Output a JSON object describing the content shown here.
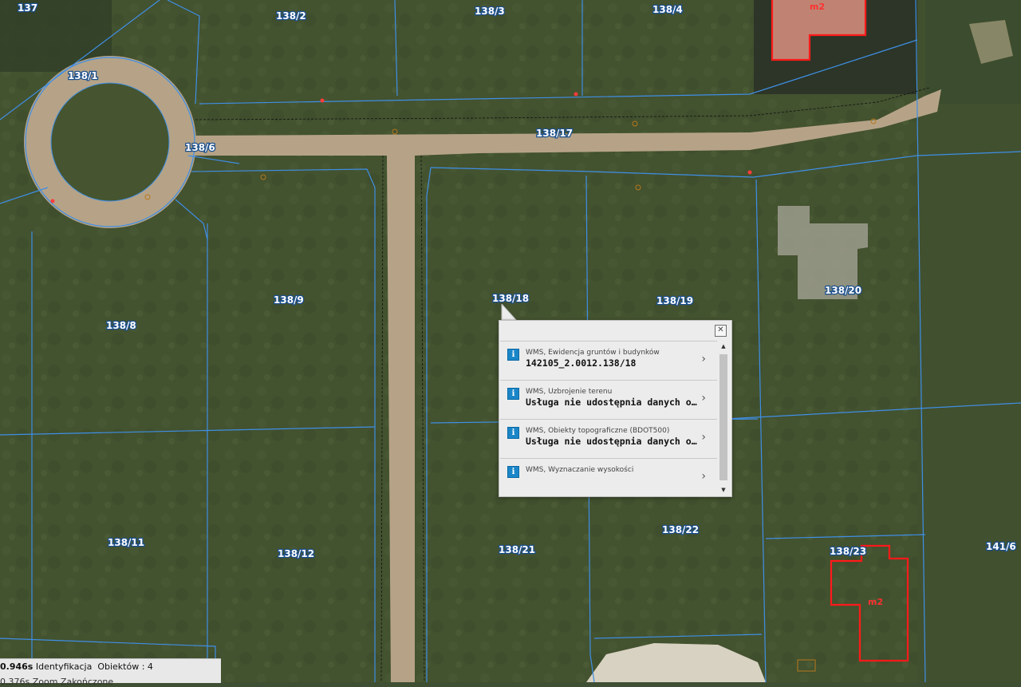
{
  "map": {
    "parcels": [
      {
        "id": "p137",
        "label": "137"
      },
      {
        "id": "p138_2",
        "label": "138/2"
      },
      {
        "id": "p138_3",
        "label": "138/3"
      },
      {
        "id": "p138_4",
        "label": "138/4"
      },
      {
        "id": "p138_1",
        "label": "138/1"
      },
      {
        "id": "p138_6",
        "label": "138/6"
      },
      {
        "id": "p138_17",
        "label": "138/17"
      },
      {
        "id": "p138_8",
        "label": "138/8"
      },
      {
        "id": "p138_9",
        "label": "138/9"
      },
      {
        "id": "p138_18",
        "label": "138/18"
      },
      {
        "id": "p138_19",
        "label": "138/19"
      },
      {
        "id": "p138_20",
        "label": "138/20"
      },
      {
        "id": "p138_11",
        "label": "138/11"
      },
      {
        "id": "p138_12",
        "label": "138/12"
      },
      {
        "id": "p138_21",
        "label": "138/21"
      },
      {
        "id": "p138_22",
        "label": "138/22"
      },
      {
        "id": "p138_23",
        "label": "138/23"
      },
      {
        "id": "p141_6",
        "label": "141/6"
      }
    ],
    "building_labels": [
      "m2",
      "m2"
    ],
    "colors": {
      "parcel_line": "#3f8fe6",
      "building": "#ff1a1a",
      "label_halo": "#1b4f8c",
      "road": "#b6a387"
    }
  },
  "popup": {
    "close_label": "✕",
    "items": [
      {
        "source": "WMS, Ewidencja gruntów i budynków",
        "value": "142105_2.0012.138/18"
      },
      {
        "source": "WMS, Uzbrojenie terenu",
        "value": "Usługa nie udostępnia danych opisowych"
      },
      {
        "source": "WMS, Obiekty topograficzne (BDOT500)",
        "value": "Usługa nie udostępnia danych opisowych"
      },
      {
        "source": "WMS, Wyznaczanie wysokości",
        "value": ""
      }
    ],
    "info_icon": "i",
    "chevron": "›",
    "scroll_up": "▲",
    "scroll_down": "▼"
  },
  "status": {
    "time": "0.946s",
    "mode": "Identyfikacja",
    "count_label": "Obiektów : 4",
    "line2": "0.376s Zoom Zakończone"
  }
}
